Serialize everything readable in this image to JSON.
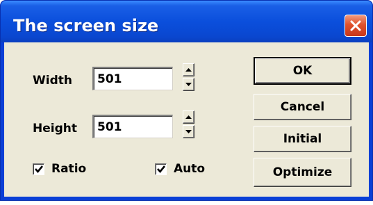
{
  "window": {
    "title": "The screen size"
  },
  "form": {
    "width_label": "Width",
    "width_value": "501",
    "height_label": "Height",
    "height_value": "501",
    "ratio_label": "Ratio",
    "ratio_checked": true,
    "auto_label": "Auto",
    "auto_checked": true
  },
  "buttons": {
    "ok": "OK",
    "cancel": "Cancel",
    "initial": "Initial",
    "optimize": "Optimize"
  },
  "icons": {
    "close": "close-icon",
    "up": "spin-up-icon",
    "down": "spin-down-icon",
    "check": "checkmark-icon"
  }
}
